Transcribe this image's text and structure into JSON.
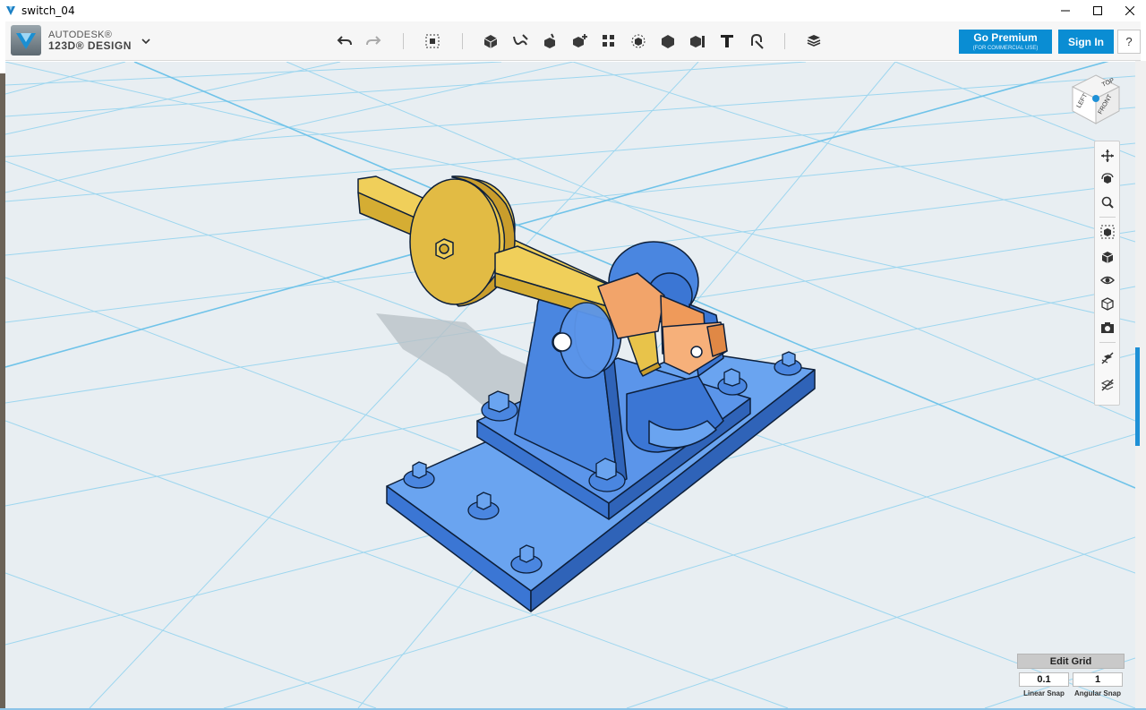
{
  "window": {
    "title": "switch_04",
    "controls": [
      "minimize-icon",
      "maximize-icon",
      "close-icon"
    ]
  },
  "brand": {
    "top": "AUTODESK®",
    "bottom": "123D® DESIGN",
    "menu_icon": "chevron-down-icon"
  },
  "toolbar": {
    "history": [
      "undo-icon",
      "redo-icon"
    ],
    "tools": [
      "transform-icon",
      "primitives-icon",
      "sketch-icon",
      "construct-icon",
      "modify-icon",
      "pattern-icon",
      "grouping-icon",
      "combine-icon",
      "measure-icon",
      "text-icon",
      "snap-icon",
      "material-icon"
    ],
    "premium_label": "Go Premium",
    "premium_sub": "(FOR COMMERCIAL USE)",
    "signin_label": "Sign In",
    "help_label": "?"
  },
  "viewcube": {
    "top": "TOP",
    "left": "LEFT",
    "front": "FRONT"
  },
  "navbar": {
    "buttons": [
      "pan-icon",
      "orbit-icon",
      "zoom-icon",
      "fit-icon",
      "perspective-icon",
      "visibility-icon",
      "materials-outlines-icon",
      "camera-icon",
      "snap-grid-icon",
      "hide-grid-icon"
    ]
  },
  "grid": {
    "edit_label": "Edit Grid",
    "linear_value": "0.1",
    "angular_value": "1",
    "linear_label": "Linear Snap",
    "angular_label": "Angular Snap"
  },
  "colors": {
    "accent": "#0a8dd3",
    "viewport_bg": "#e8eef2",
    "grid_line": "#8fd0ec",
    "part_blue": "#4f8fe6",
    "part_yellow": "#e6c24a",
    "part_orange": "#ef9a5a"
  }
}
